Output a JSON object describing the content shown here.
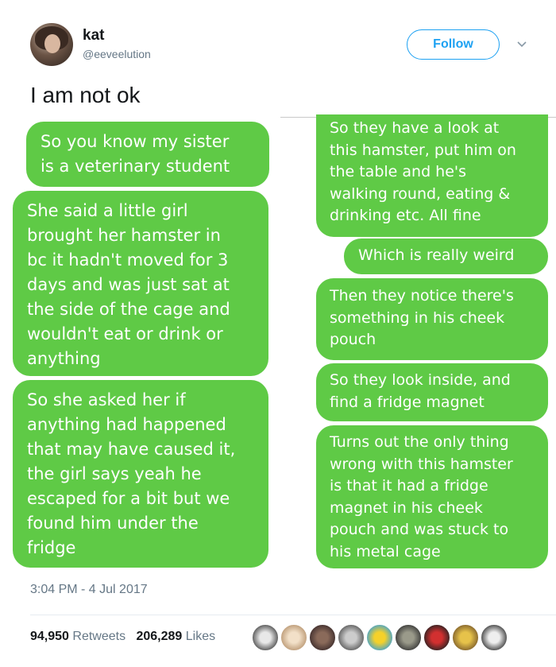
{
  "user": {
    "name": "kat",
    "handle": "@eeveelution"
  },
  "follow_label": "Follow",
  "tweet_text": "I am not ok",
  "left_messages": [
    "So you know my sister\nis a veterinary student",
    "She said a little girl\nbrought her hamster in\nbc it hadn't moved for 3\ndays and was just sat at\nthe side of the cage and\nwouldn't eat or drink or\nanything",
    "So she asked her if\nanything had happened\nthat may have caused it,\nthe girl says yeah he\nescaped for a bit but we\nfound him under the\nfridge"
  ],
  "right_messages": [
    "So they have a look at\nthis hamster, put him on\nthe table and he's\nwalking round, eating &\ndrinking etc. All fine",
    "Which is really weird",
    "Then they notice there's\nsomething in his cheek\npouch",
    "So they look inside, and\nfind a fridge magnet",
    "Turns out the only thing\nwrong with this hamster\nis that it had a fridge\nmagnet in his cheek\npouch and was stuck to\nhis metal cage"
  ],
  "timestamp": "3:04 PM - 4 Jul 2017",
  "stats": {
    "retweets_count": "94,950",
    "retweets_label": "Retweets",
    "likes_count": "206,289",
    "likes_label": "Likes"
  },
  "colors": {
    "bubble": "#5fca46",
    "accent": "#1da1f2"
  },
  "icons": {
    "menu": "chevron-down-icon"
  }
}
